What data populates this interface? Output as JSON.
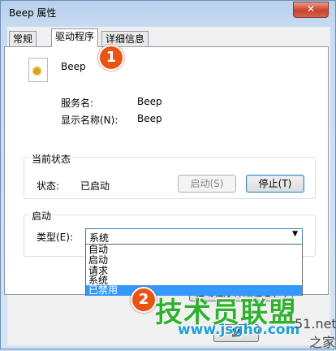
{
  "window": {
    "title": "Beep 属性",
    "close_glyph": "✕"
  },
  "tabs": [
    {
      "label": "常规"
    },
    {
      "label": "驱动程序",
      "active": true
    },
    {
      "label": "详细信息"
    }
  ],
  "driver": {
    "name": "Beep",
    "icon": "gear-icon",
    "service_name_label": "服务名:",
    "service_name_value": "Beep",
    "display_name_label": "显示名称(N):",
    "display_name_value": "Beep"
  },
  "status_group": {
    "title": "当前状态",
    "status_label": "状态:",
    "status_value": "已启动",
    "start_button": "启动(S)",
    "stop_button": "停止(T)"
  },
  "startup_group": {
    "title": "启动",
    "type_label": "类型(E):",
    "type_value": "系统",
    "options": [
      "自动",
      "启动",
      "请求",
      "系统",
      "已禁用"
    ],
    "highlighted_option": "已禁用"
  },
  "partial_button": "驱动程序详细信息(D)",
  "partial_ok": "确",
  "badges": {
    "one": "1",
    "two": "2"
  },
  "watermark": {
    "text": "技术员联盟",
    "url": "www.jsgho.com",
    "side1": "51.net",
    "side2": "之家"
  },
  "colors": {
    "selection": "#3399ff",
    "badge": "#e85512",
    "watermark_green": "#2fb12f",
    "watermark_blue": "#1d9fd8"
  }
}
